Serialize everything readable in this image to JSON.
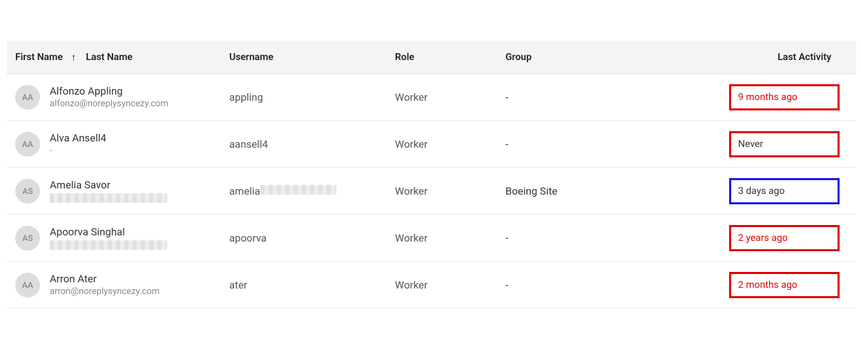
{
  "columns": {
    "first": "First Name",
    "last": "Last Name",
    "username": "Username",
    "role": "Role",
    "group": "Group",
    "activity": "Last Activity"
  },
  "rows": [
    {
      "initials": "AA",
      "name": "Alfonzo Appling",
      "email": "alfonzo@noreplysyncezy.com",
      "email_redacted": false,
      "username": "appling",
      "username_redacted": false,
      "role": "Worker",
      "group": "-",
      "activity": "9 months ago",
      "activity_color": "red",
      "box_color": "red"
    },
    {
      "initials": "AA",
      "name": "Alva Ansell4",
      "email": "-",
      "email_redacted": false,
      "username": "aansell4",
      "username_redacted": false,
      "role": "Worker",
      "group": "-",
      "activity": "Never",
      "activity_color": "dark",
      "box_color": "red"
    },
    {
      "initials": "AS",
      "name": "Amelia Savor",
      "email": "",
      "email_redacted": true,
      "username_prefix": "amelia",
      "username_redacted": true,
      "role": "Worker",
      "group": "Boeing Site",
      "activity": "3 days ago",
      "activity_color": "dark",
      "box_color": "blue"
    },
    {
      "initials": "AS",
      "name": "Apoorva Singhal",
      "email": "",
      "email_redacted": true,
      "username": "apoorva",
      "username_redacted": false,
      "role": "Worker",
      "group": "-",
      "activity": "2 years ago",
      "activity_color": "red",
      "box_color": "red"
    },
    {
      "initials": "AA",
      "name": "Arron Ater",
      "email": "arron@noreplysyncezy.com",
      "email_redacted": false,
      "username": "ater",
      "username_redacted": false,
      "role": "Worker",
      "group": "-",
      "activity": "2 months ago",
      "activity_color": "red",
      "box_color": "red"
    }
  ]
}
